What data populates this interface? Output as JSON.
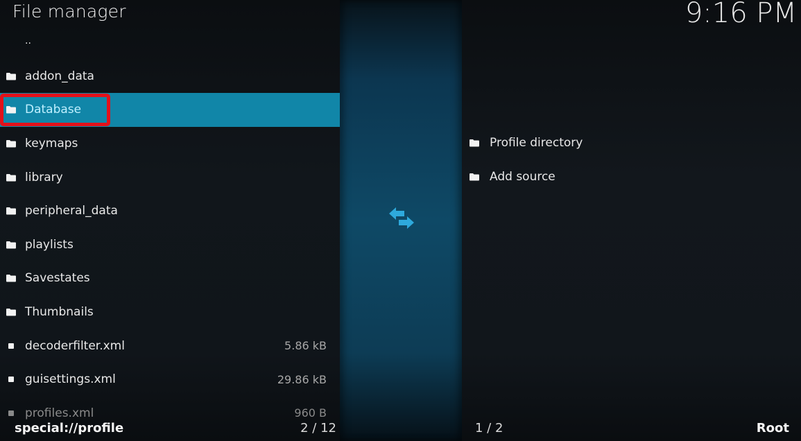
{
  "header": {
    "title": "File manager",
    "clock": "9:16 PM"
  },
  "left_pane": {
    "parent_label": "..",
    "items": [
      {
        "name": "addon_data",
        "type": "folder",
        "size": ""
      },
      {
        "name": "Database",
        "type": "folder",
        "size": "",
        "selected": true
      },
      {
        "name": "keymaps",
        "type": "folder",
        "size": ""
      },
      {
        "name": "library",
        "type": "folder",
        "size": ""
      },
      {
        "name": "peripheral_data",
        "type": "folder",
        "size": ""
      },
      {
        "name": "playlists",
        "type": "folder",
        "size": ""
      },
      {
        "name": "Savestates",
        "type": "folder",
        "size": ""
      },
      {
        "name": "Thumbnails",
        "type": "folder",
        "size": ""
      },
      {
        "name": "decoderfilter.xml",
        "type": "file",
        "size": "5.86 kB"
      },
      {
        "name": "guisettings.xml",
        "type": "file",
        "size": "29.86 kB"
      },
      {
        "name": "profiles.xml",
        "type": "file",
        "size": "960 B"
      }
    ],
    "footer": {
      "path": "special://profile",
      "count": "2 / 12"
    }
  },
  "middle": {
    "swap_icon": "swap-arrows-icon"
  },
  "right_pane": {
    "items": [
      {
        "name": "Profile directory",
        "type": "folder"
      },
      {
        "name": "Add source",
        "type": "folder"
      }
    ],
    "footer": {
      "count": "1 / 2",
      "path": "Root"
    }
  },
  "colors": {
    "selection": "#1186a8",
    "highlight_border": "#e2111a",
    "swap_icon": "#2ea9dc"
  }
}
